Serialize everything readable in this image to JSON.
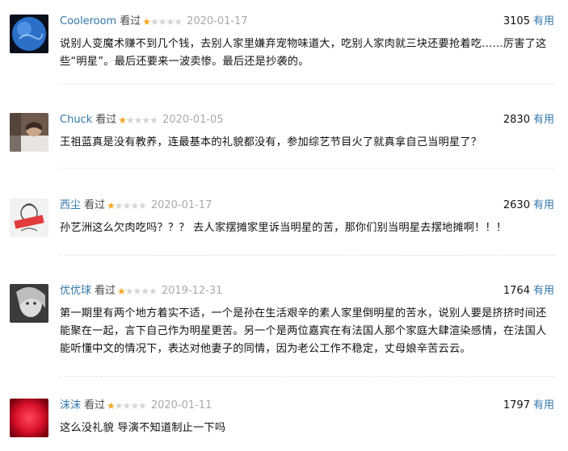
{
  "ui": {
    "useful_label": "有用"
  },
  "reviews": [
    {
      "user": "Cooleroom",
      "status": "看过",
      "rating": 1,
      "date": "2020-01-17",
      "votes": "3105",
      "text": "说别人变魔术赚不到几个钱，去别人家里嫌弃宠物味道大，吃别人家肉就三块还要抢着吃……厉害了这些“明星”。最后还要来一波卖惨。最后还是抄袭的。"
    },
    {
      "user": "Chuck",
      "status": "看过",
      "rating": 1,
      "date": "2020-01-05",
      "votes": "2830",
      "text": "王祖蓝真是没有教养，连最基本的礼貌都没有，参加综艺节目火了就真拿自己当明星了？"
    },
    {
      "user": "西尘",
      "status": "看过",
      "rating": 1,
      "date": "2020-01-17",
      "votes": "2630",
      "text": "孙艺洲这么欠肉吃吗？？？ 去人家摆摊家里诉当明星的苦，那你们别当明星去摆地摊啊！！！"
    },
    {
      "user": "优优球",
      "status": "看过",
      "rating": 1,
      "date": "2019-12-31",
      "votes": "1764",
      "text": "第一期里有两个地方着实不适，一个是孙在生活艰辛的素人家里倒明星的苦水，说别人要是挤挤时间还能聚在一起，言下自己作为明星更苦。另一个是两位嘉宾在有法国人那个家庭大肆渲染感情，在法国人能听懂中文的情况下，表达对他妻子的同情，因为老公工作不稳定，丈母娘辛苦云云。"
    },
    {
      "user": "沫沫",
      "status": "看过",
      "rating": 1,
      "date": "2020-01-11",
      "votes": "1797",
      "text": "这么没礼貌 导演不知道制止一下吗"
    }
  ]
}
